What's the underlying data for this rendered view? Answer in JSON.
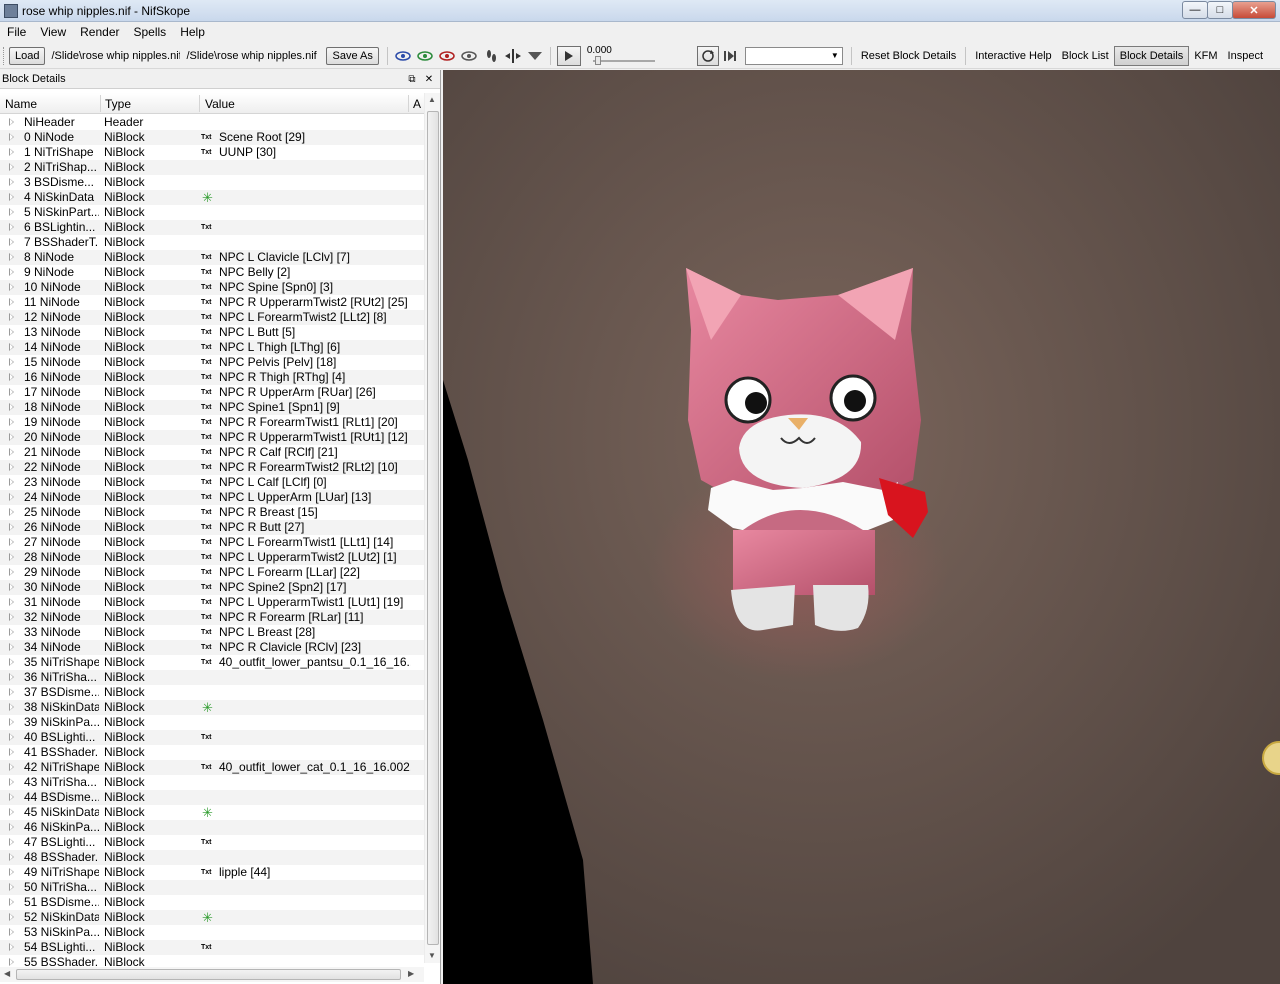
{
  "window": {
    "title": "rose whip nipples.nif - NifSkope",
    "minimize": "—",
    "maximize": "□",
    "close": "✕"
  },
  "menu": [
    "File",
    "View",
    "Render",
    "Spells",
    "Help"
  ],
  "toolbar": {
    "load_label": "Load",
    "load_path": "/Slide\\rose whip nipples.nif",
    "save_path": "/Slide\\rose whip nipples.nif",
    "save_as_label": "Save As",
    "time_value": "0.000",
    "anim_progress": 0.0,
    "links": [
      "Reset Block Details",
      "Interactive Help",
      "Block List",
      "Block Details",
      "KFM",
      "Inspect"
    ],
    "active_link": "Block Details"
  },
  "panel": {
    "title": "Block Details",
    "columns": {
      "name": "Name",
      "type": "Type",
      "value": "Value",
      "extra": "A"
    }
  },
  "rows": [
    {
      "name": "NiHeader",
      "type": "Header",
      "tag": "",
      "value": ""
    },
    {
      "name": "0 NiNode",
      "type": "NiBlock",
      "tag": "Txt",
      "value": "Scene Root [29]"
    },
    {
      "name": "1 NiTriShape",
      "type": "NiBlock",
      "tag": "Txt",
      "value": "UUNP [30]"
    },
    {
      "name": "2 NiTriShap...",
      "type": "NiBlock",
      "tag": "",
      "value": ""
    },
    {
      "name": "3 BSDisme...",
      "type": "NiBlock",
      "tag": "",
      "value": ""
    },
    {
      "name": "4 NiSkinData",
      "type": "NiBlock",
      "tag": "star",
      "value": ""
    },
    {
      "name": "5 NiSkinPart...",
      "type": "NiBlock",
      "tag": "",
      "value": ""
    },
    {
      "name": "6 BSLightin...",
      "type": "NiBlock",
      "tag": "Txt",
      "value": ""
    },
    {
      "name": "7 BSShaderT...",
      "type": "NiBlock",
      "tag": "",
      "value": ""
    },
    {
      "name": "8 NiNode",
      "type": "NiBlock",
      "tag": "Txt",
      "value": "NPC L Clavicle [LClv] [7]"
    },
    {
      "name": "9 NiNode",
      "type": "NiBlock",
      "tag": "Txt",
      "value": "NPC Belly [2]"
    },
    {
      "name": "10 NiNode",
      "type": "NiBlock",
      "tag": "Txt",
      "value": "NPC Spine [Spn0] [3]"
    },
    {
      "name": "11 NiNode",
      "type": "NiBlock",
      "tag": "Txt",
      "value": "NPC R UpperarmTwist2 [RUt2] [25]"
    },
    {
      "name": "12 NiNode",
      "type": "NiBlock",
      "tag": "Txt",
      "value": "NPC L ForearmTwist2 [LLt2] [8]"
    },
    {
      "name": "13 NiNode",
      "type": "NiBlock",
      "tag": "Txt",
      "value": "NPC L Butt [5]"
    },
    {
      "name": "14 NiNode",
      "type": "NiBlock",
      "tag": "Txt",
      "value": "NPC L Thigh [LThg] [6]"
    },
    {
      "name": "15 NiNode",
      "type": "NiBlock",
      "tag": "Txt",
      "value": "NPC Pelvis [Pelv] [18]"
    },
    {
      "name": "16 NiNode",
      "type": "NiBlock",
      "tag": "Txt",
      "value": "NPC R Thigh [RThg] [4]"
    },
    {
      "name": "17 NiNode",
      "type": "NiBlock",
      "tag": "Txt",
      "value": "NPC R UpperArm [RUar] [26]"
    },
    {
      "name": "18 NiNode",
      "type": "NiBlock",
      "tag": "Txt",
      "value": "NPC Spine1 [Spn1] [9]"
    },
    {
      "name": "19 NiNode",
      "type": "NiBlock",
      "tag": "Txt",
      "value": "NPC R ForearmTwist1 [RLt1] [20]"
    },
    {
      "name": "20 NiNode",
      "type": "NiBlock",
      "tag": "Txt",
      "value": "NPC R UpperarmTwist1 [RUt1] [12]"
    },
    {
      "name": "21 NiNode",
      "type": "NiBlock",
      "tag": "Txt",
      "value": "NPC R Calf [RClf] [21]"
    },
    {
      "name": "22 NiNode",
      "type": "NiBlock",
      "tag": "Txt",
      "value": "NPC R ForearmTwist2 [RLt2] [10]"
    },
    {
      "name": "23 NiNode",
      "type": "NiBlock",
      "tag": "Txt",
      "value": "NPC L Calf [LClf] [0]"
    },
    {
      "name": "24 NiNode",
      "type": "NiBlock",
      "tag": "Txt",
      "value": "NPC L UpperArm [LUar] [13]"
    },
    {
      "name": "25 NiNode",
      "type": "NiBlock",
      "tag": "Txt",
      "value": "NPC R Breast [15]"
    },
    {
      "name": "26 NiNode",
      "type": "NiBlock",
      "tag": "Txt",
      "value": "NPC R Butt [27]"
    },
    {
      "name": "27 NiNode",
      "type": "NiBlock",
      "tag": "Txt",
      "value": "NPC L ForearmTwist1 [LLt1] [14]"
    },
    {
      "name": "28 NiNode",
      "type": "NiBlock",
      "tag": "Txt",
      "value": "NPC L UpperarmTwist2 [LUt2] [1]"
    },
    {
      "name": "29 NiNode",
      "type": "NiBlock",
      "tag": "Txt",
      "value": "NPC L Forearm [LLar] [22]"
    },
    {
      "name": "30 NiNode",
      "type": "NiBlock",
      "tag": "Txt",
      "value": "NPC Spine2 [Spn2] [17]"
    },
    {
      "name": "31 NiNode",
      "type": "NiBlock",
      "tag": "Txt",
      "value": "NPC L UpperarmTwist1 [LUt1] [19]"
    },
    {
      "name": "32 NiNode",
      "type": "NiBlock",
      "tag": "Txt",
      "value": "NPC R Forearm [RLar] [11]"
    },
    {
      "name": "33 NiNode",
      "type": "NiBlock",
      "tag": "Txt",
      "value": "NPC L Breast [28]"
    },
    {
      "name": "34 NiNode",
      "type": "NiBlock",
      "tag": "Txt",
      "value": "NPC R Clavicle [RClv] [23]"
    },
    {
      "name": "35 NiTriShape",
      "type": "NiBlock",
      "tag": "Txt",
      "value": "40_outfit_lower_pantsu_0.1_16_16..."
    },
    {
      "name": "36 NiTriSha...",
      "type": "NiBlock",
      "tag": "",
      "value": ""
    },
    {
      "name": "37 BSDisme...",
      "type": "NiBlock",
      "tag": "",
      "value": ""
    },
    {
      "name": "38 NiSkinData",
      "type": "NiBlock",
      "tag": "star",
      "value": ""
    },
    {
      "name": "39 NiSkinPa...",
      "type": "NiBlock",
      "tag": "",
      "value": ""
    },
    {
      "name": "40 BSLighti...",
      "type": "NiBlock",
      "tag": "Txt",
      "value": ""
    },
    {
      "name": "41 BSShader...",
      "type": "NiBlock",
      "tag": "",
      "value": ""
    },
    {
      "name": "42 NiTriShape",
      "type": "NiBlock",
      "tag": "Txt",
      "value": "40_outfit_lower_cat_0.1_16_16.002..."
    },
    {
      "name": "43 NiTriSha...",
      "type": "NiBlock",
      "tag": "",
      "value": ""
    },
    {
      "name": "44 BSDisme...",
      "type": "NiBlock",
      "tag": "",
      "value": ""
    },
    {
      "name": "45 NiSkinData",
      "type": "NiBlock",
      "tag": "star",
      "value": ""
    },
    {
      "name": "46 NiSkinPa...",
      "type": "NiBlock",
      "tag": "",
      "value": ""
    },
    {
      "name": "47 BSLighti...",
      "type": "NiBlock",
      "tag": "Txt",
      "value": ""
    },
    {
      "name": "48 BSShader...",
      "type": "NiBlock",
      "tag": "",
      "value": ""
    },
    {
      "name": "49 NiTriShape",
      "type": "NiBlock",
      "tag": "Txt",
      "value": "lipple [44]"
    },
    {
      "name": "50 NiTriSha...",
      "type": "NiBlock",
      "tag": "",
      "value": ""
    },
    {
      "name": "51 BSDisme...",
      "type": "NiBlock",
      "tag": "",
      "value": ""
    },
    {
      "name": "52 NiSkinData",
      "type": "NiBlock",
      "tag": "star",
      "value": ""
    },
    {
      "name": "53 NiSkinPa...",
      "type": "NiBlock",
      "tag": "",
      "value": ""
    },
    {
      "name": "54 BSLighti...",
      "type": "NiBlock",
      "tag": "Txt",
      "value": ""
    },
    {
      "name": "55 BSShader...",
      "type": "NiBlock",
      "tag": "",
      "value": ""
    }
  ],
  "viewport": {
    "icons": [
      "cat-figure-icon",
      "skin-surface-icon"
    ],
    "colors": {
      "skin": "#5d4e47",
      "cat_pink": "#d86a85",
      "bow_red": "#d8141e"
    }
  }
}
